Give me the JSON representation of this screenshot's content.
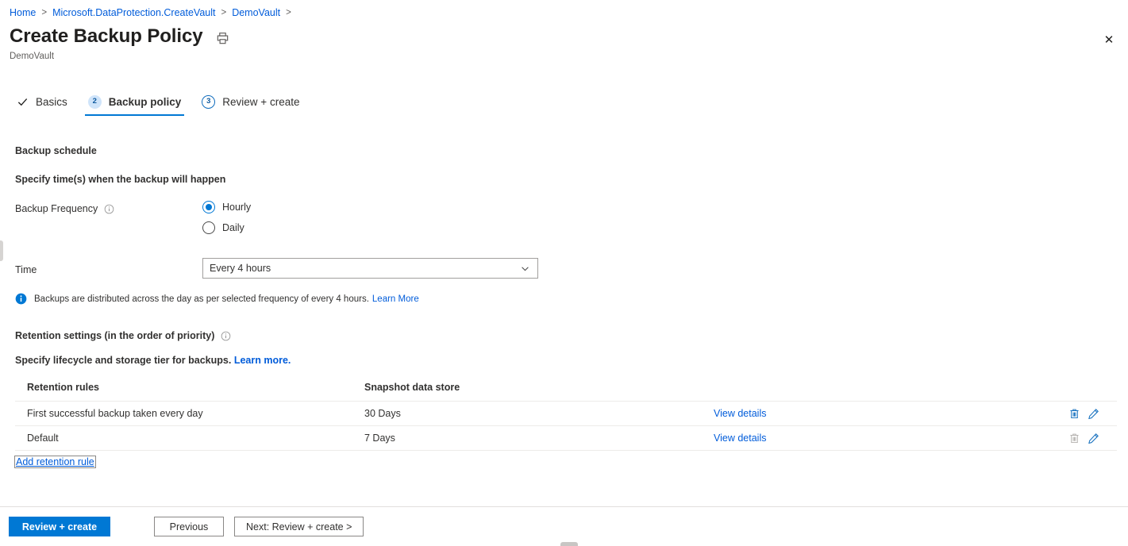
{
  "breadcrumb": {
    "items": [
      {
        "label": "Home"
      },
      {
        "label": "Microsoft.DataProtection.CreateVault"
      },
      {
        "label": "DemoVault"
      }
    ],
    "separator": ">"
  },
  "header": {
    "title": "Create Backup Policy",
    "subtitle": "DemoVault",
    "print_icon": "printer-icon",
    "close_icon": "close-icon",
    "close_label": "✕"
  },
  "wizard": {
    "tabs": [
      {
        "label": "Basics",
        "badge": "✓",
        "state": "complete"
      },
      {
        "label": "Backup policy",
        "badge": "2",
        "state": "active"
      },
      {
        "label": "Review + create",
        "badge": "3",
        "state": "pending"
      }
    ]
  },
  "schedule": {
    "section_title": "Backup schedule",
    "section_subtitle": "Specify time(s) when the backup will happen",
    "frequency_label": "Backup Frequency",
    "frequency_info_icon": "info-circle-icon",
    "frequency_options": [
      {
        "label": "Hourly",
        "selected": true
      },
      {
        "label": "Daily",
        "selected": false
      }
    ],
    "time_label": "Time",
    "time_value": "Every 4 hours",
    "time_chevron_icon": "chevron-down-icon",
    "banner_icon": "info-filled-icon",
    "banner_text": "Backups are distributed across the day as per selected frequency of every 4 hours.",
    "banner_link": "Learn More"
  },
  "retention": {
    "title": "Retention settings (in the order of priority)",
    "title_info_icon": "info-circle-icon",
    "subtitle": "Specify lifecycle and storage tier for backups.",
    "subtitle_link": "Learn more.",
    "columns": [
      "Retention rules",
      "Snapshot data store"
    ],
    "rows": [
      {
        "rule": "First successful backup taken every day",
        "store": "30 Days",
        "details_link": "View details",
        "delete_icon": "trash-icon",
        "delete_enabled": true,
        "edit_icon": "pencil-icon",
        "edit_enabled": true
      },
      {
        "rule": "Default",
        "store": "7 Days",
        "details_link": "View details",
        "delete_icon": "trash-icon",
        "delete_enabled": false,
        "edit_icon": "pencil-icon",
        "edit_enabled": true
      }
    ],
    "add_rule_link": "Add retention rule"
  },
  "footer": {
    "primary": "Review + create",
    "previous": "Previous",
    "next": "Next: Review + create >"
  },
  "colors": {
    "accent": "#0078d4",
    "link": "#015cda",
    "badge_fill": "#cfe4fa",
    "text": "#323130",
    "border": "#edebe9",
    "disabled_icon": "#b3b0ad"
  }
}
